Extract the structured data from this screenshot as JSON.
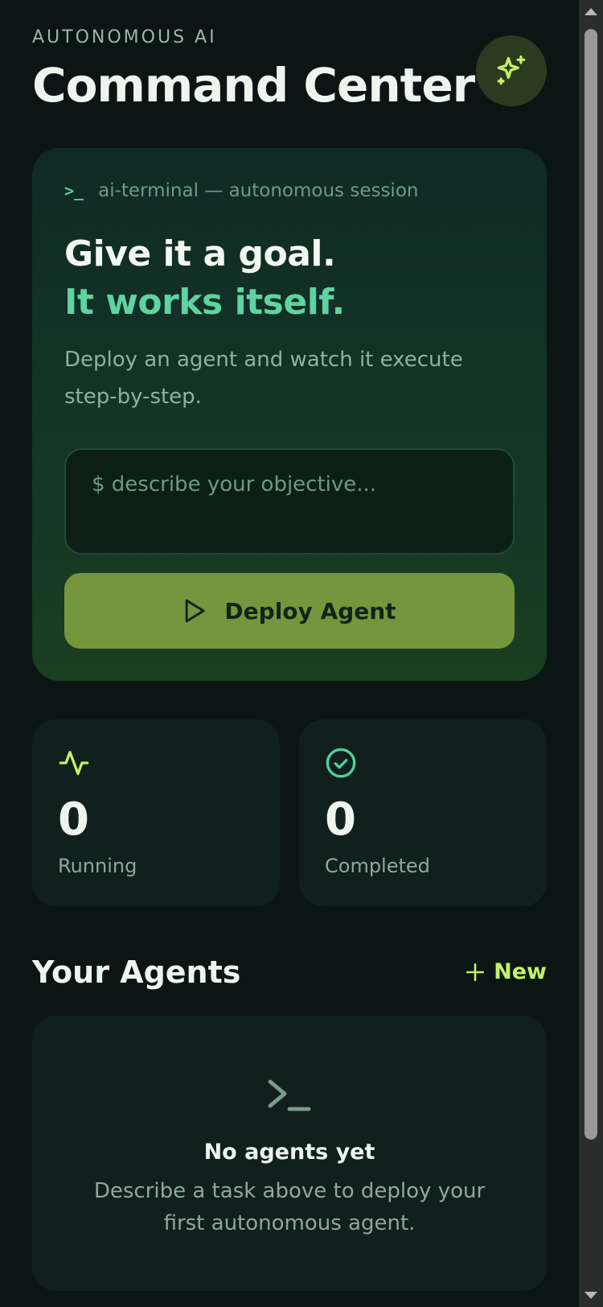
{
  "header": {
    "eyebrow": "AUTONOMOUS AI",
    "title": "Command Center",
    "sparkle_icon": "sparkle-icon"
  },
  "hero": {
    "terminal_label": "ai-terminal — autonomous session",
    "headline_1": "Give it a goal.",
    "headline_2": "It works itself.",
    "description": "Deploy an agent and watch it execute step-by-step.",
    "input_placeholder": "$ describe your objective...",
    "input_value": "",
    "deploy_label": "Deploy Agent"
  },
  "stats": [
    {
      "icon": "activity-icon",
      "value": "0",
      "label": "Running"
    },
    {
      "icon": "check-circle-icon",
      "value": "0",
      "label": "Completed"
    }
  ],
  "agents": {
    "title": "Your Agents",
    "new_label": "New",
    "empty_title": "No agents yet",
    "empty_description": "Describe a task above to deploy your first autonomous agent."
  },
  "colors": {
    "background": "#0b1614",
    "accent_lime": "#c5f06a",
    "accent_mint": "#5fd3a0",
    "button": "#76963d"
  }
}
